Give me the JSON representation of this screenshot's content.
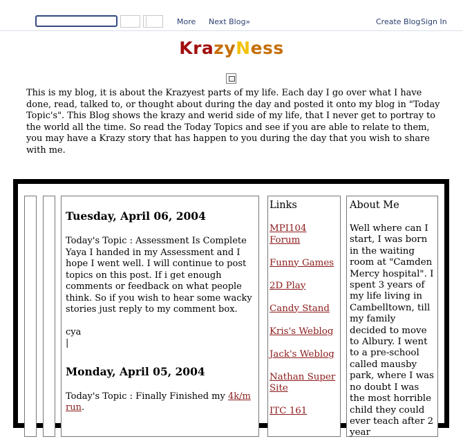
{
  "navbar": {
    "search_value": "",
    "more": "More",
    "next_blog": "Next Blog»",
    "create_blog": "Create Blog",
    "sign_in": "Sign In"
  },
  "header": {
    "title_part1": "Kra",
    "title_part2": "zy",
    "title_part3": "N",
    "title_part4": "ess",
    "description": "This is my blog, it is about the Krazyest parts of my life. Each day I go over what I have done, read, talked to, or thought about during the day and posted it onto my blog in \"Today Topic's\". This Blog shows the krazy and werid side of my life, that I never get to portray to the world all the time. So read the Today Topics and see if you are able to relate to them, you may have a Krazy story that has happen to you during the day that you wish to share with me."
  },
  "posts": [
    {
      "date": "Tuesday, April 06, 2004",
      "body": "Today's Topic : Assessment Is Complete Yaya I handed in my Assessment and I hope I went well. I will continue to post topics on this post. If i get enough comments or feedback on what people think. So if you wish to hear some wacky stories just reply to my comment box.",
      "signoff": "cya",
      "cursor": "|"
    },
    {
      "date": "Monday, April 05, 2004",
      "body_prefix": "Today's Topic : Finally Finished my ",
      "link_text": "4k/m run",
      "body_suffix": "."
    }
  ],
  "sidebar": {
    "links_title": "Links",
    "links": [
      "MPI104 Forum",
      "Funny Games",
      "2D Play",
      "Candy Stand",
      "Kris's Weblog",
      "Jack's Weblog",
      "Nathan Super Site",
      "ITC 161"
    ],
    "about_title": "About Me",
    "about_text": "Well where can I start, I was born in the waiting room at \"Camden Mercy hospital\". I spent 3 years of my life living in Cambelltown, till my family decided to move to Albury. I went to a pre-school called mausby park, where I was no doubt I was the most horrible child they could ever teach after 2 year"
  },
  "colors": {
    "title_red": "#a30f0f",
    "title_orange": "#c56f08",
    "title_yellow": "#f4c20e",
    "link": "#8c1b1b",
    "nav_text": "#2a3f6e",
    "frame": "#000000"
  }
}
